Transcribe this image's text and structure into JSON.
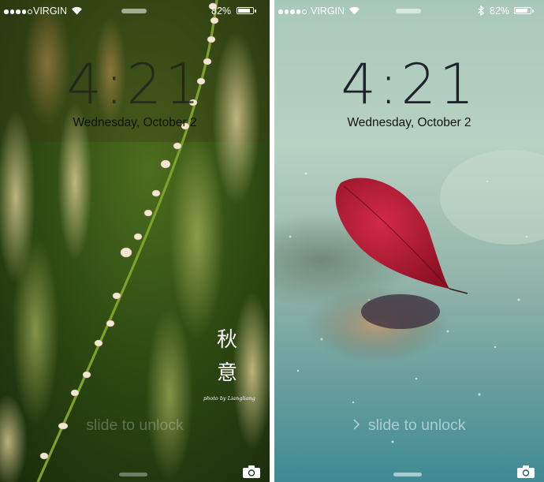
{
  "screens": [
    {
      "name": "left",
      "carrier": "VIRGIN",
      "battery_percent": "82%",
      "battery_level": 0.82,
      "time": "4:21",
      "date": "Wednesday, October 2",
      "slide_text": "slide to unlock",
      "calligraphy": [
        "秋",
        "意"
      ],
      "photo_credit": "photo by Liangliang",
      "icons": [
        "wifi-icon",
        "battery-icon",
        "camera-icon"
      ],
      "colors": {
        "clock": "#1e1e1e",
        "accent": "#ffffff"
      }
    },
    {
      "name": "right",
      "carrier": "VIRGIN",
      "battery_percent": "82%",
      "battery_level": 0.82,
      "time": "4:21",
      "date": "Wednesday, October 2",
      "slide_text": "slide to unlock",
      "icons": [
        "wifi-icon",
        "bluetooth-icon",
        "battery-icon",
        "chevron-right-icon",
        "camera-icon"
      ],
      "colors": {
        "clock": "#1d2328",
        "leaf": "#b01830"
      }
    }
  ]
}
